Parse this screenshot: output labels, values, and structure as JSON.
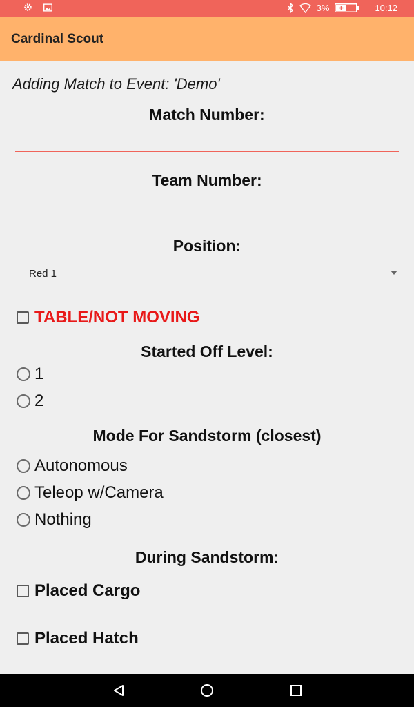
{
  "status_bar": {
    "battery": "3%",
    "time": "10:12",
    "icons": [
      "gear-icon",
      "image-icon",
      "bluetooth-icon",
      "wifi-icon",
      "battery-icon"
    ]
  },
  "app_bar": {
    "title": "Cardinal Scout"
  },
  "form": {
    "adding_text": "Adding Match to Event: 'Demo'",
    "match_number_label": "Match Number:",
    "match_number_value": "",
    "team_number_label": "Team Number:",
    "team_number_value": "",
    "position_label": "Position:",
    "position_value": "Red 1",
    "table_not_moving": {
      "label": "TABLE/NOT MOVING",
      "checked": false,
      "color": "#e81919"
    },
    "started_off_level": {
      "label": "Started Off Level:",
      "options": [
        "1",
        "2"
      ]
    },
    "sandstorm_mode": {
      "label": "Mode For Sandstorm (closest)",
      "options": [
        "Autonomous",
        "Teleop w/Camera",
        "Nothing"
      ]
    },
    "during_sandstorm": {
      "label": "During Sandstorm:",
      "options": [
        "Placed Cargo",
        "Placed Hatch"
      ]
    }
  },
  "colors": {
    "status_bar": "#f0645a",
    "app_bar": "#ffb26b",
    "accent": "#f0645a",
    "background": "#efefef"
  },
  "nav_bar": {
    "icons": [
      "back-icon",
      "home-icon",
      "recents-icon"
    ]
  }
}
